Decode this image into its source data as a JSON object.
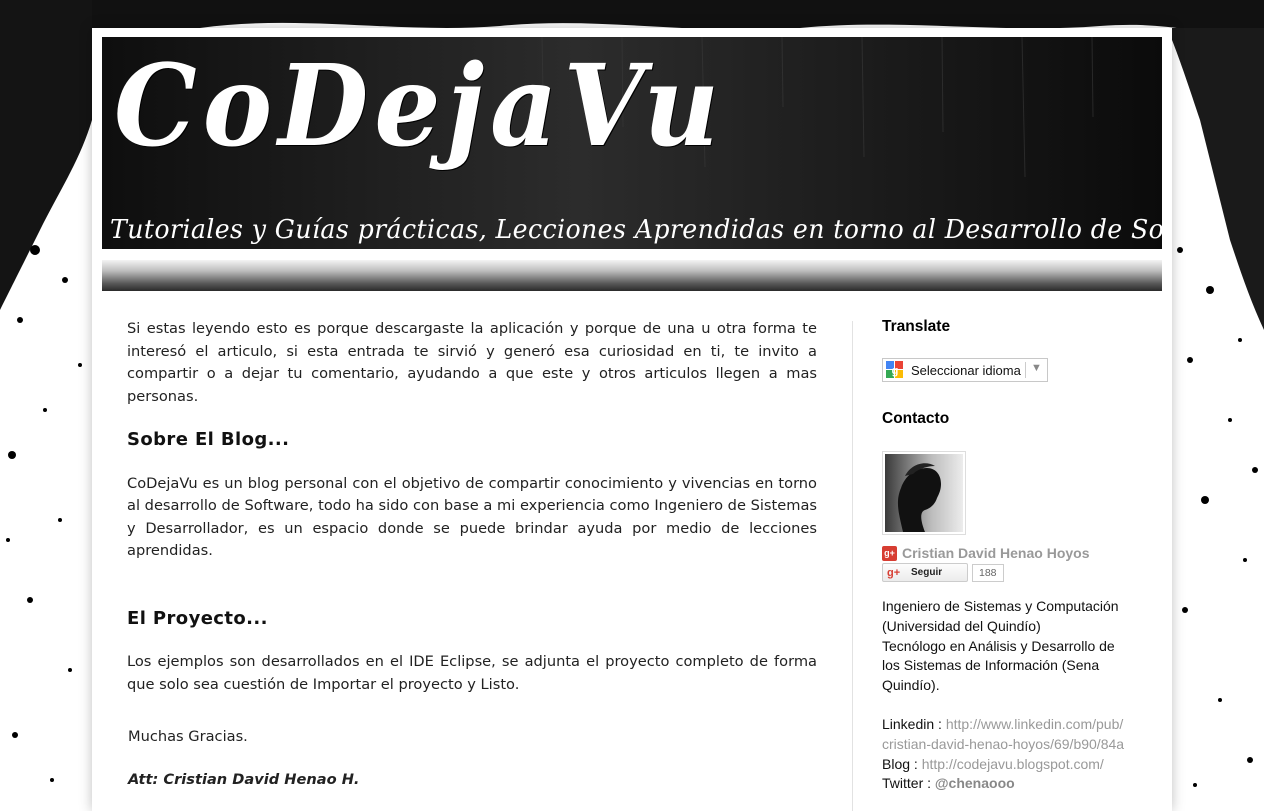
{
  "blog": {
    "title": "CoDejaVu",
    "description": "Tutoriales y Guías prácticas, Lecciones Aprendidas en torno al Desarrollo de Software!!!"
  },
  "main": {
    "intro": "Si estas leyendo esto es porque descargaste la aplicación y porque de una u otra forma te interesó el articulo, si esta entrada te sirvió y generó esa curiosidad en ti, te invito a compartir o a dejar tu comentario, ayudando a que este y otros articulos llegen a mas personas.",
    "about_heading": "Sobre El Blog...",
    "about_text": "CoDejaVu es un blog personal con el objetivo de compartir conocimiento y vivencias en torno al desarrollo de Software, todo ha sido con base a mi experiencia como Ingeniero de Sistemas y Desarrollador, es un espacio donde se puede brindar ayuda por medio de lecciones aprendidas.",
    "project_heading": "El Proyecto...",
    "project_text": "Los ejemplos son desarrollados en el IDE Eclipse, se adjunta el proyecto completo de forma que solo sea cuestión de Importar el proyecto y Listo.",
    "thanks": "Muchas Gracias.",
    "signature": "Att: Cristian David Henao H."
  },
  "sidebar": {
    "translate": {
      "title": "Translate",
      "select_label": "Seleccionar idioma",
      "arrow": "▼"
    },
    "contact": {
      "title": "Contacto",
      "profile_name": "Cristian David Henao Hoyos",
      "gplus_badge": "g+",
      "follow_label": "Seguir",
      "follow_icon": "g+",
      "follow_count": "188",
      "bio_line1": "Ingeniero de Sistemas y Computación",
      "bio_line2": "(Universidad del Quindío)",
      "bio_line3": "Tecnólogo en Análisis y Desarrollo de",
      "bio_line4": "los Sistemas de Información (Sena",
      "bio_line5": "Quindío).",
      "linkedin_label": "Linkedin : ",
      "linkedin_url_1": "http://www.linkedin.com/pub/",
      "linkedin_url_2": "cristian-david-henao-hoyos/69/b90/84a",
      "blog_label": "Blog : ",
      "blog_url": "http://codejavu.blogspot.com/",
      "twitter_label": "Twitter : ",
      "twitter_handle": "@chenaooo"
    }
  },
  "colors": {
    "header_bg": "#161616",
    "link_gray": "#999999",
    "gplus_red": "#d73d32"
  }
}
